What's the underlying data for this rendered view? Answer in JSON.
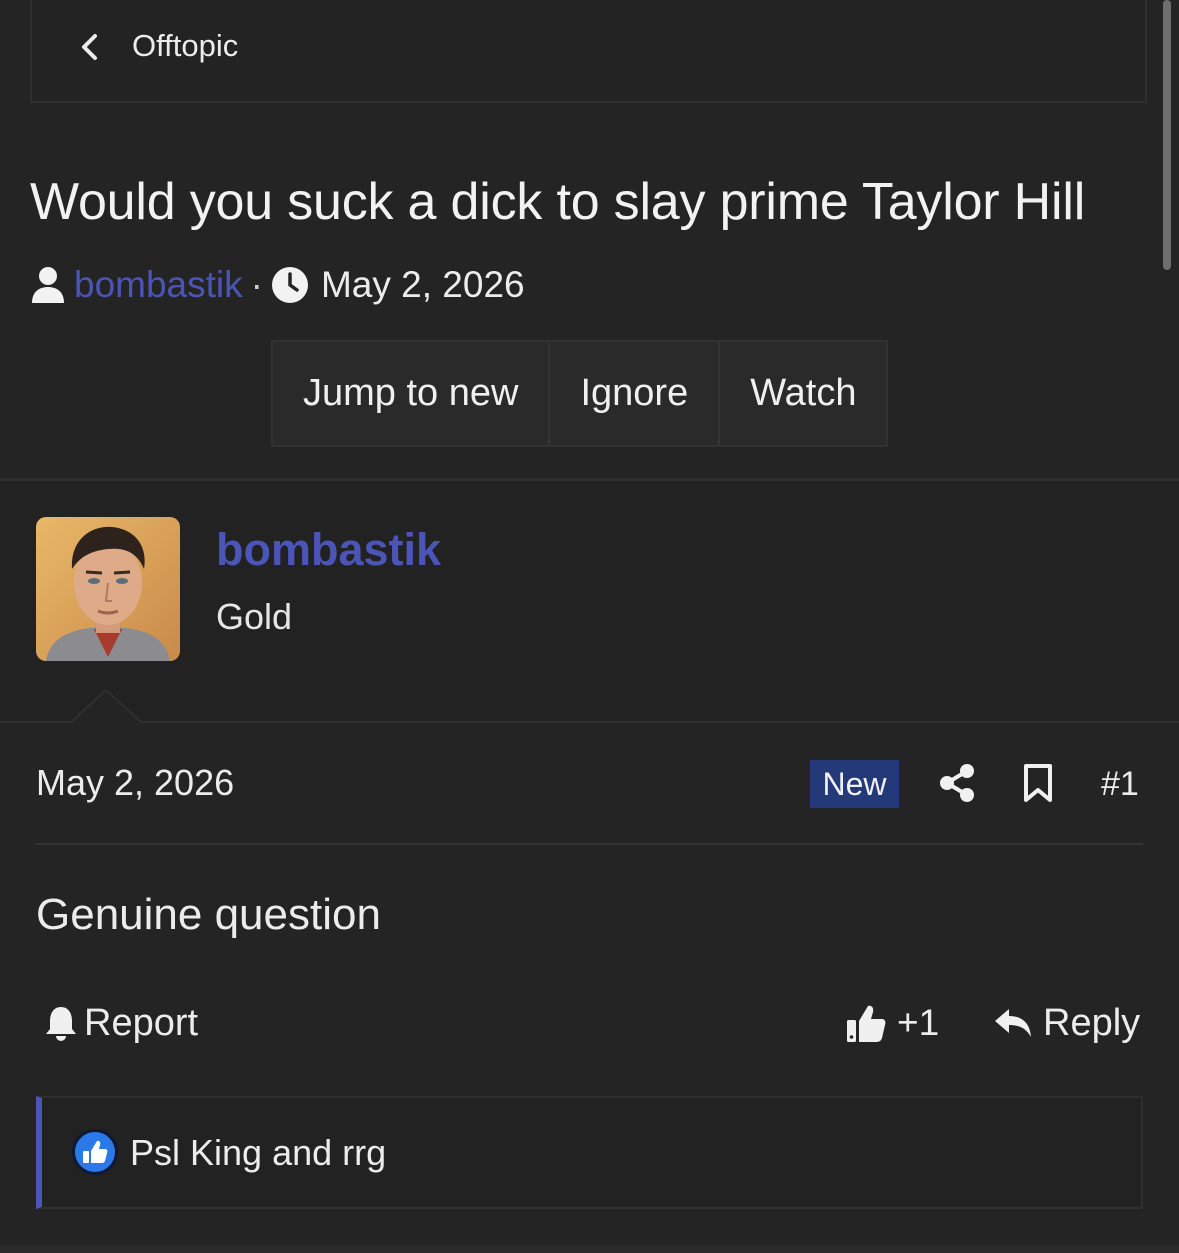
{
  "breadcrumb": {
    "label": "Offtopic"
  },
  "thread": {
    "title": "Would you suck a dick to slay prime Taylor Hill",
    "author": "bombastik",
    "separator": "·",
    "date": "May 2, 2026"
  },
  "actions": {
    "jump_label": "Jump to new",
    "ignore_label": "Ignore",
    "watch_label": "Watch"
  },
  "post": {
    "username": "bombastik",
    "user_title": "Gold",
    "date": "May 2, 2026",
    "badge": "New",
    "number": "#1",
    "body": "Genuine question",
    "report_label": "Report",
    "like_count": "+1",
    "reply_label": "Reply",
    "reactions_text": "Psl King and rrg"
  },
  "colors": {
    "background": "#242424",
    "link": "#4b55b8",
    "badge": "#243a78",
    "reaction_blue": "#2b78e8"
  },
  "icons": [
    "chevron-left-icon",
    "user-icon",
    "clock-icon",
    "share-icon",
    "bookmark-icon",
    "bell-icon",
    "thumbs-up-icon",
    "reply-icon",
    "like-reaction-icon"
  ]
}
